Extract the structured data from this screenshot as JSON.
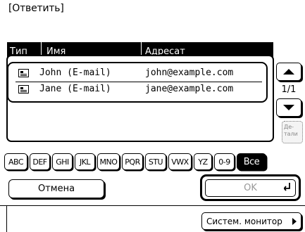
{
  "title": "[Ответить]",
  "table": {
    "headers": [
      "Тип",
      "Имя",
      "Адресат"
    ],
    "rows": [
      {
        "icon": "address-card-icon",
        "name": "John (E-mail)",
        "address": "john@example.com"
      },
      {
        "icon": "address-card-icon",
        "name": "Jane (E-mail)",
        "address": "jane@example.com"
      }
    ]
  },
  "pagination": {
    "page_label": "1/1"
  },
  "details_label": "Де-тали",
  "index_keys": [
    "ABC",
    "DEF",
    "GHI",
    "JKL",
    "MNO",
    "PQR",
    "STU",
    "VWX",
    "YZ",
    "0-9",
    "Все"
  ],
  "active_key": "Все",
  "buttons": {
    "cancel": "Отмена",
    "ok": "OK",
    "system_monitor": "Систем. монитор"
  }
}
